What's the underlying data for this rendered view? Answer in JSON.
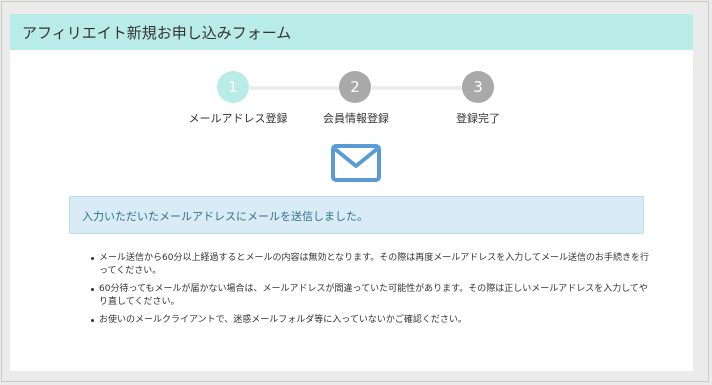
{
  "page": {
    "title": "アフィリエイト新規お申し込みフォーム"
  },
  "steps": [
    {
      "number": "1",
      "label": "メールアドレス登録",
      "state": "active"
    },
    {
      "number": "2",
      "label": "会員情報登録",
      "state": "inactive"
    },
    {
      "number": "3",
      "label": "登録完了",
      "state": "inactive"
    }
  ],
  "icons": {
    "mail": "envelope-icon"
  },
  "alert": {
    "message": "入力いただいたメールアドレスにメールを送信しました。"
  },
  "notes": [
    "メール送信から60分以上経過するとメールの内容は無効となります。その際は再度メールアドレスを入力してメール送信のお手続きを行ってください。",
    "60分待ってもメールが届かない場合は、メールアドレスが間違っていた可能性があります。その際は正しいメールアドレスを入力してやり直してください。",
    "お使いのメールクライアントで、迷惑メールフォルダ等に入っていないかご確認ください。"
  ],
  "colors": {
    "header_bg": "#b9ebe8",
    "step_active": "#b9ebe8",
    "step_inactive": "#a9a9a9",
    "mail_icon": "#5b9bd5",
    "alert_bg": "#d9ecf6",
    "alert_text": "#31708f"
  }
}
